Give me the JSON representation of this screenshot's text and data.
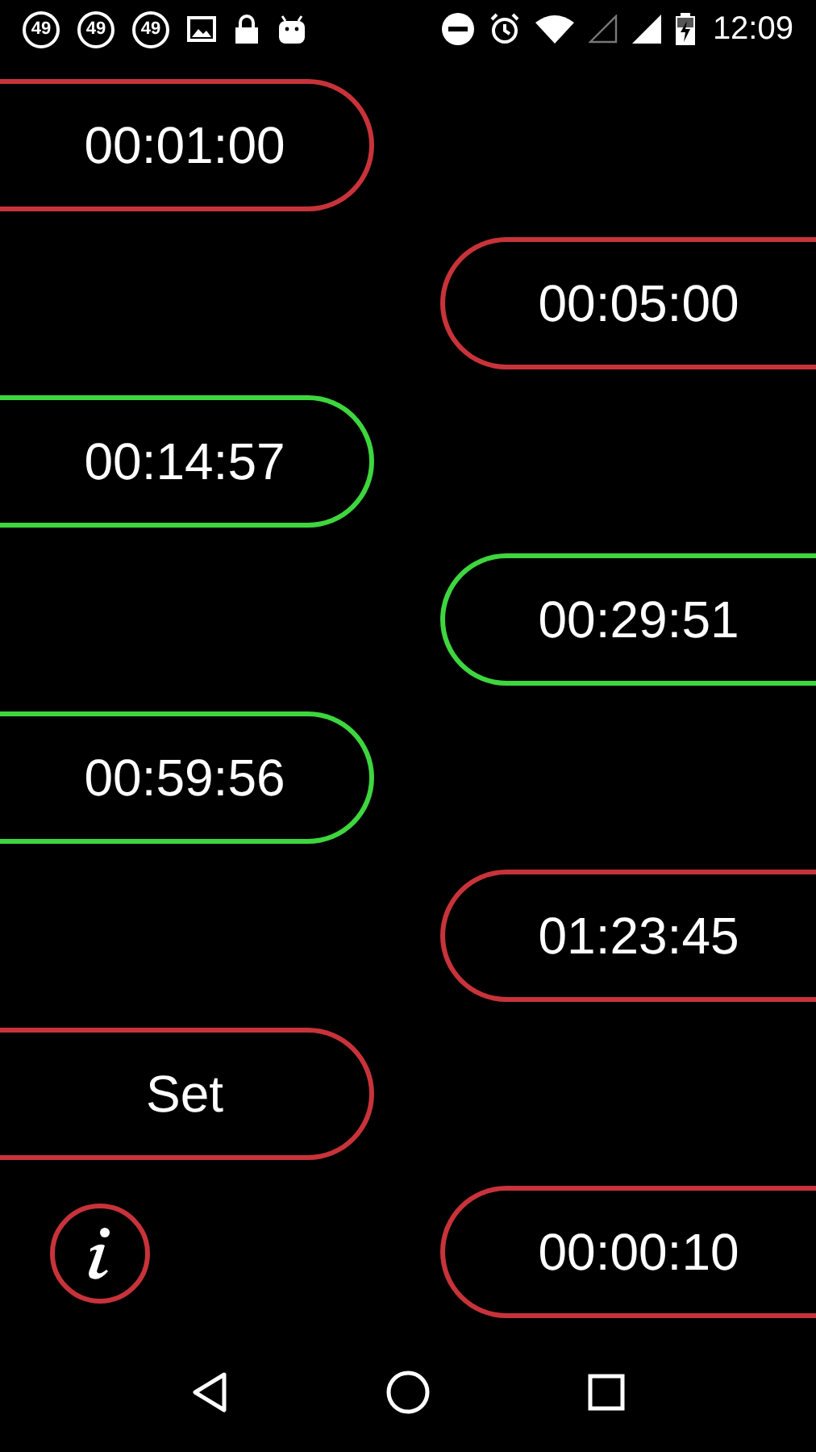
{
  "status_bar": {
    "badges": [
      "49",
      "49",
      "49"
    ],
    "time": "12:09"
  },
  "buttons": [
    {
      "label": "00:01:00",
      "kind": "left",
      "active": false
    },
    {
      "label": "00:05:00",
      "kind": "right",
      "active": false
    },
    {
      "label": "00:14:57",
      "kind": "left",
      "active": true
    },
    {
      "label": "00:29:51",
      "kind": "right",
      "active": true
    },
    {
      "label": "00:59:56",
      "kind": "left",
      "active": true
    },
    {
      "label": "01:23:45",
      "kind": "right",
      "active": false
    },
    {
      "label": "Set",
      "kind": "left",
      "active": false
    },
    {
      "label": "00:00:10",
      "kind": "right",
      "active": false
    }
  ]
}
